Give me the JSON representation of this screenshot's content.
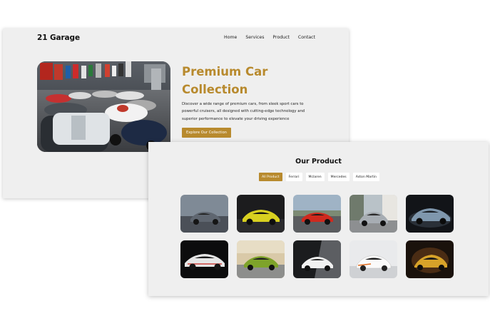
{
  "site": {
    "brand": "21 Garage"
  },
  "nav": {
    "items": [
      "Home",
      "Services",
      "Product",
      "Contact"
    ]
  },
  "hero": {
    "title": "Premium Car Collection",
    "description": "Discover a wide range of premium cars, from sleek sport cars to powerful cruisers, all designed with cutting-edge technology and superior performance to elevate your driving experience",
    "cta_label": "Explore Our Collection"
  },
  "products": {
    "heading": "Our Product",
    "filters": [
      "All Product",
      "Ferrari",
      "Mclaren",
      "Mercedes",
      "Aston Martin"
    ],
    "active_filter": "All Product",
    "thumbnails": [
      {
        "name": "car-photo-grey-supercar"
      },
      {
        "name": "car-photo-yellow-mclaren"
      },
      {
        "name": "car-photo-red-ferrari"
      },
      {
        "name": "car-photo-silver-mercedes"
      },
      {
        "name": "car-photo-blue-aston-martin"
      },
      {
        "name": "car-photo-white-mclaren-p1"
      },
      {
        "name": "car-photo-green-mclaren"
      },
      {
        "name": "car-photo-white-mercedes"
      },
      {
        "name": "car-photo-white-orange-mclaren"
      },
      {
        "name": "car-photo-gold-supercar"
      }
    ]
  },
  "colors": {
    "accent": "#b88a2e",
    "page_bg": "#efefef"
  }
}
